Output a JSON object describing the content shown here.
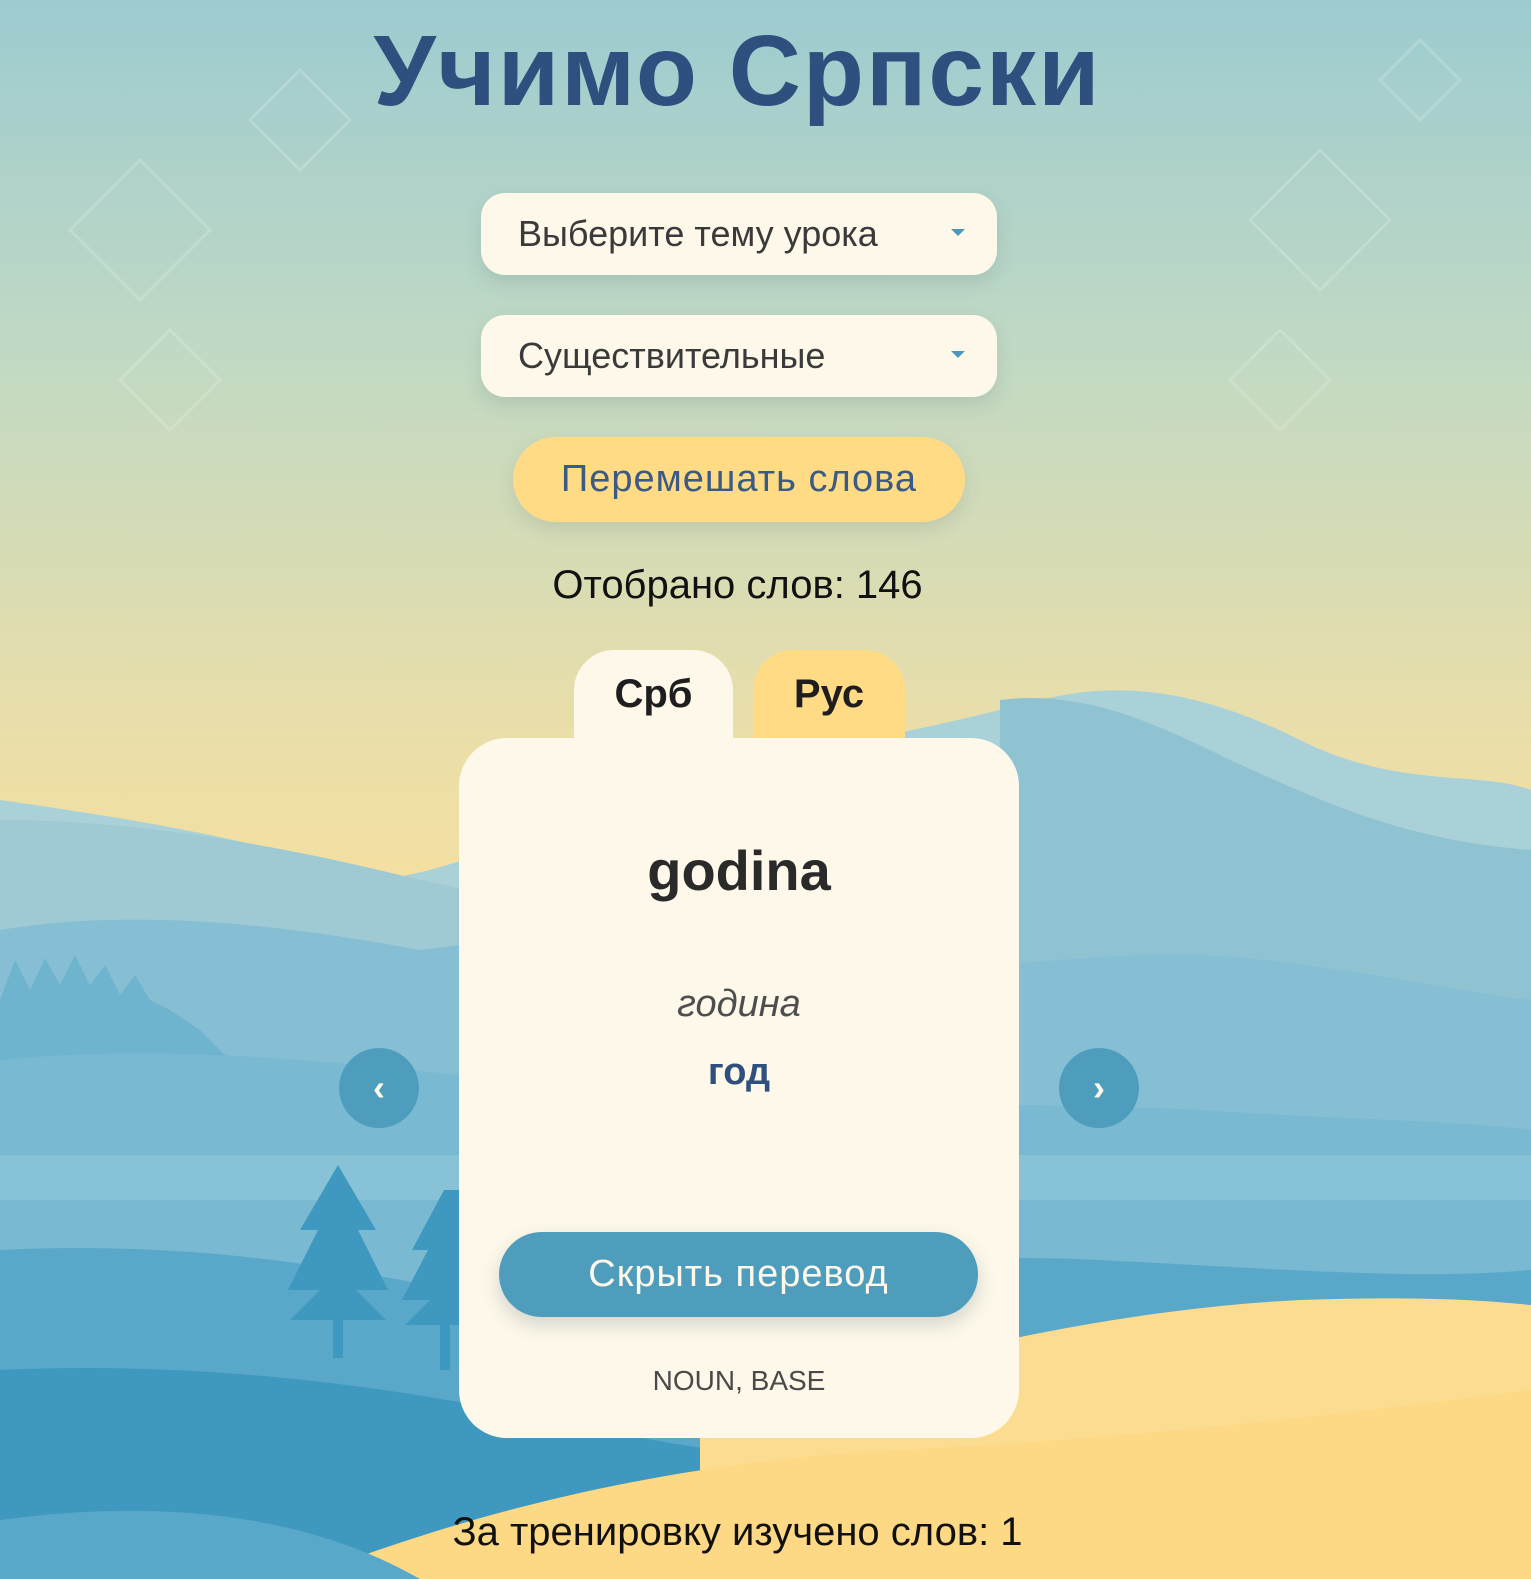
{
  "app": {
    "title": "Учимо Српски"
  },
  "controls": {
    "theme_select": {
      "value": "Выберите тему урока",
      "icon": "chevron-down-icon"
    },
    "category_select": {
      "value": "Существительные",
      "icon": "chevron-down-icon"
    },
    "shuffle_label": "Перемешать слова",
    "selected_count": "Отобрано слов: 146"
  },
  "tabs": [
    {
      "label": "Срб",
      "active": true
    },
    {
      "label": "Рус",
      "active": false
    }
  ],
  "card": {
    "word": "godina",
    "cyrillic": "година",
    "translation": "год",
    "hide_translation_label": "Скрыть перевод",
    "tags": "NOUN, BASE"
  },
  "navigation": {
    "prev_label": "‹",
    "next_label": "›"
  },
  "footer": {
    "learned_count": "За тренировку изучено слов: 1"
  },
  "colors": {
    "title": "#2f4f7e",
    "card_bg": "#fdf8e9",
    "accent_yellow": "#fedb84",
    "accent_blue": "#4f9dbd"
  }
}
